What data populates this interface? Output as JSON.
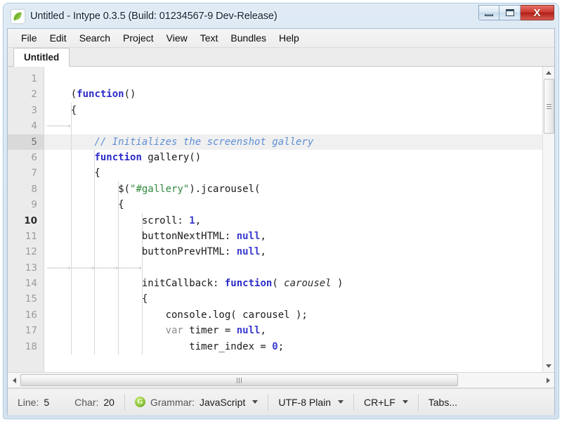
{
  "window": {
    "title": "Untitled - Intype 0.3.5 (Build: 01234567-9 Dev-Release)",
    "app_icon": "intype-leaf-icon",
    "controls": {
      "minimize": "–",
      "maximize": "□",
      "close": "X"
    },
    "accent_close": "#b02018",
    "accent_frame": "#9cc2de"
  },
  "menubar": {
    "items": [
      {
        "label": "File"
      },
      {
        "label": "Edit"
      },
      {
        "label": "Search"
      },
      {
        "label": "Project"
      },
      {
        "label": "View"
      },
      {
        "label": "Text"
      },
      {
        "label": "Bundles"
      },
      {
        "label": "Help"
      }
    ]
  },
  "tabs": [
    {
      "label": "Untitled",
      "active": true
    }
  ],
  "editor": {
    "current_line": 5,
    "lines": [
      {
        "n": 1,
        "tokens": []
      },
      {
        "n": 2,
        "tokens": [
          {
            "t": "    (",
            "c": "pln"
          },
          {
            "t": "function",
            "c": "kw"
          },
          {
            "t": "()",
            "c": "pln"
          }
        ]
      },
      {
        "n": 3,
        "tokens": [
          {
            "t": "    {",
            "c": "pln"
          }
        ]
      },
      {
        "n": 4,
        "tokens": [
          {
            "t": "———→",
            "c": "ws"
          }
        ]
      },
      {
        "n": 5,
        "tokens": [
          {
            "t": "        // Initializes the screenshot gallery",
            "c": "cmt"
          }
        ]
      },
      {
        "n": 6,
        "tokens": [
          {
            "t": "        ",
            "c": "pln"
          },
          {
            "t": "function",
            "c": "kw"
          },
          {
            "t": " gallery()",
            "c": "pln"
          }
        ]
      },
      {
        "n": 7,
        "tokens": [
          {
            "t": "        {",
            "c": "pln"
          }
        ]
      },
      {
        "n": 8,
        "tokens": [
          {
            "t": "            $(",
            "c": "pln"
          },
          {
            "t": "\"#gallery\"",
            "c": "str"
          },
          {
            "t": ").jcarousel(",
            "c": "pln"
          }
        ]
      },
      {
        "n": 9,
        "tokens": [
          {
            "t": "            {",
            "c": "pln"
          }
        ]
      },
      {
        "n": 10,
        "tokens": [
          {
            "t": "                scroll: ",
            "c": "pln"
          },
          {
            "t": "1",
            "c": "num"
          },
          {
            "t": ",",
            "c": "pln"
          }
        ]
      },
      {
        "n": 11,
        "tokens": [
          {
            "t": "                buttonNextHTML: ",
            "c": "pln"
          },
          {
            "t": "null",
            "c": "nul"
          },
          {
            "t": ",",
            "c": "pln"
          }
        ]
      },
      {
        "n": 12,
        "tokens": [
          {
            "t": "                buttonPrevHTML: ",
            "c": "pln"
          },
          {
            "t": "null",
            "c": "nul"
          },
          {
            "t": ",",
            "c": "pln"
          }
        ]
      },
      {
        "n": 13,
        "tokens": [
          {
            "t": "———→———→———→———→",
            "c": "ws"
          }
        ]
      },
      {
        "n": 14,
        "tokens": [
          {
            "t": "                initCallback: ",
            "c": "pln"
          },
          {
            "t": "function",
            "c": "kw"
          },
          {
            "t": "( ",
            "c": "pln"
          },
          {
            "t": "carousel",
            "c": "par"
          },
          {
            "t": " )",
            "c": "pln"
          }
        ]
      },
      {
        "n": 15,
        "tokens": [
          {
            "t": "                {",
            "c": "pln"
          }
        ]
      },
      {
        "n": 16,
        "tokens": [
          {
            "t": "                    console.log( carousel );",
            "c": "pln"
          }
        ]
      },
      {
        "n": 17,
        "tokens": [
          {
            "t": "                    ",
            "c": "pln"
          },
          {
            "t": "var",
            "c": "kw2"
          },
          {
            "t": " timer = ",
            "c": "pln"
          },
          {
            "t": "null",
            "c": "nul"
          },
          {
            "t": ",",
            "c": "pln"
          }
        ]
      },
      {
        "n": 18,
        "tokens": [
          {
            "t": "                        timer_index = ",
            "c": "pln"
          },
          {
            "t": "0",
            "c": "num"
          },
          {
            "t": ";",
            "c": "pln"
          }
        ]
      }
    ],
    "colors": {
      "keyword": "#2b2bc8",
      "string": "#2e8b3d",
      "number": "#3a3ad0",
      "comment": "#5f8fd4",
      "plain": "#1a1a1a",
      "gutter_bg": "#ebebeb",
      "current_line_bg": "#f0f0f0"
    }
  },
  "scrollbars": {
    "vertical": {
      "up_arrow": "scroll-up",
      "down_arrow": "scroll-down",
      "thumb": "vertical-thumb"
    },
    "horizontal": {
      "left_arrow": "scroll-left",
      "right_arrow": "scroll-right",
      "thumb": "horizontal-thumb"
    }
  },
  "statusbar": {
    "line_label": "Line:",
    "line_value": "5",
    "char_label": "Char:",
    "char_value": "20",
    "grammar_icon_letter": "G",
    "grammar_label": "Grammar:",
    "grammar_value": "JavaScript",
    "encoding": "UTF-8 Plain",
    "line_ending": "CR+LF",
    "tabs_label": "Tabs..."
  }
}
